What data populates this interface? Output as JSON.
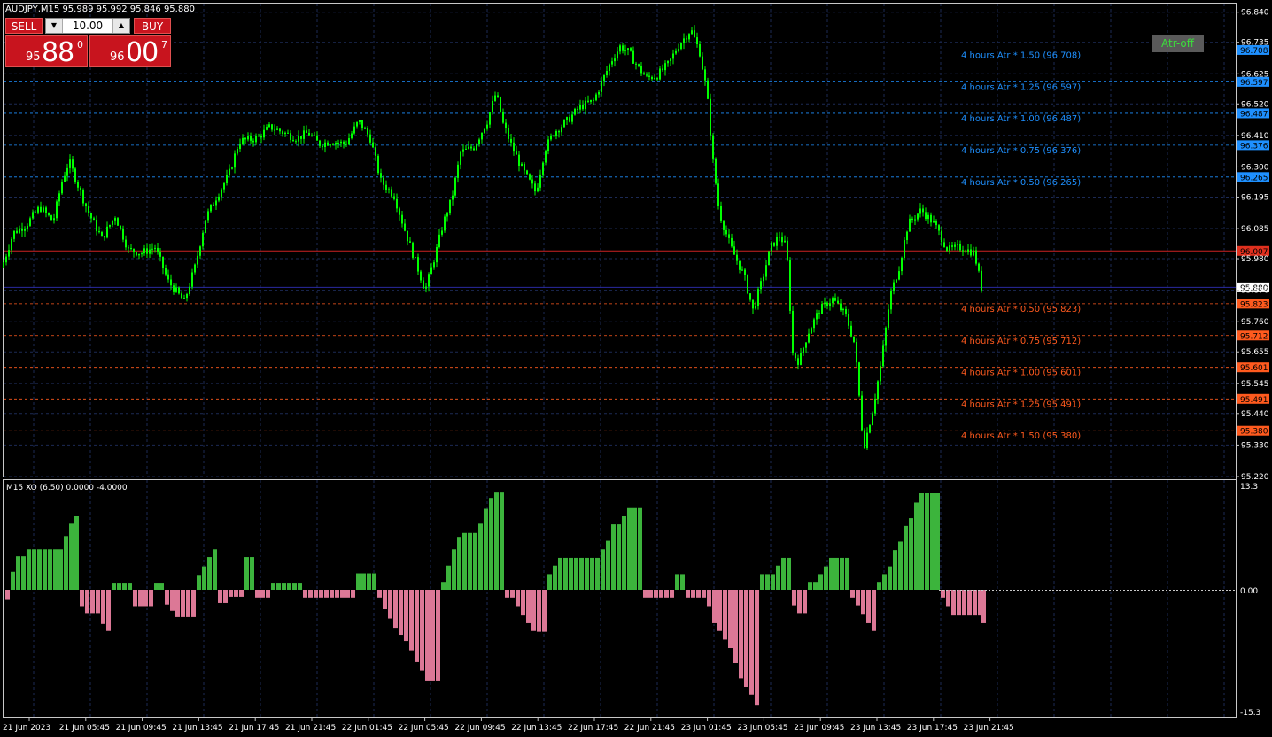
{
  "symbol_header": "AUDJPY,M15  95.989 95.992 95.846 95.880",
  "trade_panel": {
    "sell_label": "SELL",
    "buy_label": "BUY",
    "lot": "10.00",
    "sell_price_small": "95",
    "sell_price_big": "88",
    "sell_price_sup": "0",
    "buy_price_small": "96",
    "buy_price_big": "00",
    "buy_price_sup": "7"
  },
  "atr_button": "Atr-off",
  "indicator_header": "M15 XO (6.50) 0.0000 -4.0000",
  "colors": {
    "bull_candle": "#00ff00",
    "xo_up": "#3cb43c",
    "xo_down": "#dc7896",
    "atr_upper": "#1e90ff",
    "atr_lower": "#ff5a1e",
    "bid_line": "#cc2222",
    "ask_line": "#2a2aa0",
    "grid": "#1c2a55"
  },
  "price_axis_ticks": [
    "96.840",
    "96.735",
    "96.625",
    "96.520",
    "96.410",
    "96.300",
    "96.195",
    "96.085",
    "95.980",
    "95.870",
    "95.760",
    "95.655",
    "95.545",
    "95.440",
    "95.330",
    "95.220"
  ],
  "price_tags": {
    "atr_upper": [
      "96.708",
      "96.597",
      "96.487",
      "96.376",
      "96.265"
    ],
    "atr_lower": [
      "95.823",
      "95.712",
      "95.601",
      "95.491",
      "95.380"
    ],
    "ask": "96.007",
    "bid": "95.880"
  },
  "atr_upper_labels": [
    "4 hours Atr * 1.50 (96.708)",
    "4 hours Atr * 1.25 (96.597)",
    "4 hours Atr * 1.00 (96.487)",
    "4 hours Atr * 0.75 (96.376)",
    "4 hours Atr * 0.50 (96.265)"
  ],
  "atr_lower_labels": [
    "4 hours Atr * 0.50 (95.823)",
    "4 hours Atr * 0.75 (95.712)",
    "4 hours Atr * 1.00 (95.601)",
    "4 hours Atr * 1.25 (95.491)",
    "4 hours Atr * 1.50 (95.380)"
  ],
  "indicator_axis": {
    "max": "13.3",
    "zero": "0.00",
    "min": "-15.3"
  },
  "time_labels": [
    "21 Jun 2023",
    "21 Jun 05:45",
    "21 Jun 09:45",
    "21 Jun 13:45",
    "21 Jun 17:45",
    "21 Jun 21:45",
    "22 Jun 01:45",
    "22 Jun 05:45",
    "22 Jun 09:45",
    "22 Jun 13:45",
    "22 Jun 17:45",
    "22 Jun 21:45",
    "23 Jun 01:45",
    "23 Jun 05:45",
    "23 Jun 09:45",
    "23 Jun 13:45",
    "23 Jun 17:45",
    "23 Jun 21:45"
  ],
  "chart_data": {
    "type": "candlestick",
    "price_range": [
      95.22,
      96.87
    ],
    "close_path": [
      [
        0,
        95.93
      ],
      [
        15,
        96.07
      ],
      [
        30,
        96.1
      ],
      [
        45,
        96.16
      ],
      [
        60,
        96.11
      ],
      [
        70,
        96.25
      ],
      [
        78,
        96.32
      ],
      [
        90,
        96.22
      ],
      [
        100,
        96.14
      ],
      [
        115,
        96.05
      ],
      [
        130,
        96.13
      ],
      [
        145,
        96.01
      ],
      [
        160,
        96.0
      ],
      [
        175,
        96.02
      ],
      [
        190,
        95.9
      ],
      [
        208,
        95.83
      ],
      [
        220,
        95.95
      ],
      [
        232,
        96.12
      ],
      [
        245,
        96.2
      ],
      [
        258,
        96.27
      ],
      [
        270,
        96.39
      ],
      [
        290,
        96.4
      ],
      [
        305,
        96.44
      ],
      [
        320,
        96.42
      ],
      [
        335,
        96.4
      ],
      [
        348,
        96.42
      ],
      [
        360,
        96.38
      ],
      [
        375,
        96.39
      ],
      [
        390,
        96.38
      ],
      [
        405,
        96.46
      ],
      [
        418,
        96.4
      ],
      [
        430,
        96.25
      ],
      [
        445,
        96.2
      ],
      [
        458,
        96.07
      ],
      [
        468,
        95.98
      ],
      [
        480,
        95.87
      ],
      [
        492,
        96.0
      ],
      [
        500,
        96.1
      ],
      [
        510,
        96.19
      ],
      [
        520,
        96.35
      ],
      [
        535,
        96.37
      ],
      [
        550,
        96.46
      ],
      [
        560,
        96.56
      ],
      [
        568,
        96.45
      ],
      [
        578,
        96.37
      ],
      [
        590,
        96.29
      ],
      [
        605,
        96.21
      ],
      [
        615,
        96.36
      ],
      [
        625,
        96.42
      ],
      [
        640,
        96.46
      ],
      [
        655,
        96.51
      ],
      [
        670,
        96.53
      ],
      [
        680,
        96.6
      ],
      [
        690,
        96.67
      ],
      [
        700,
        96.72
      ],
      [
        710,
        96.7
      ],
      [
        720,
        96.65
      ],
      [
        730,
        96.61
      ],
      [
        742,
        96.62
      ],
      [
        755,
        96.66
      ],
      [
        765,
        96.72
      ],
      [
        780,
        96.78
      ],
      [
        790,
        96.7
      ],
      [
        798,
        96.56
      ],
      [
        805,
        96.32
      ],
      [
        812,
        96.14
      ],
      [
        825,
        96.02
      ],
      [
        840,
        95.92
      ],
      [
        850,
        95.8
      ],
      [
        860,
        95.9
      ],
      [
        870,
        96.02
      ],
      [
        880,
        96.06
      ],
      [
        888,
        96.02
      ],
      [
        895,
        95.65
      ],
      [
        902,
        95.62
      ],
      [
        912,
        95.72
      ],
      [
        925,
        95.8
      ],
      [
        940,
        95.84
      ],
      [
        955,
        95.78
      ],
      [
        965,
        95.68
      ],
      [
        975,
        95.32
      ],
      [
        985,
        95.45
      ],
      [
        995,
        95.62
      ],
      [
        1005,
        95.85
      ],
      [
        1015,
        95.95
      ],
      [
        1025,
        96.1
      ],
      [
        1040,
        96.15
      ],
      [
        1055,
        96.1
      ],
      [
        1070,
        96.01
      ],
      [
        1085,
        96.02
      ],
      [
        1100,
        96.0
      ],
      [
        1108,
        95.88
      ]
    ],
    "xo_histogram": [
      [
        6,
        -1.2
      ],
      [
        12,
        2.3
      ],
      [
        18,
        4.3
      ],
      [
        24,
        4.3
      ],
      [
        30,
        5.2
      ],
      [
        36,
        5.2
      ],
      [
        42,
        5.2
      ],
      [
        48,
        5.2
      ],
      [
        54,
        5.2
      ],
      [
        60,
        5.2
      ],
      [
        66,
        5.2
      ],
      [
        72,
        6.9
      ],
      [
        78,
        8.6
      ],
      [
        84,
        9.5
      ],
      [
        90,
        -2.1
      ],
      [
        96,
        -3.0
      ],
      [
        102,
        -3.0
      ],
      [
        108,
        -3.0
      ],
      [
        114,
        -4.3
      ],
      [
        120,
        -5.2
      ],
      [
        126,
        0.9
      ],
      [
        132,
        0.9
      ],
      [
        138,
        0.9
      ],
      [
        144,
        0.9
      ],
      [
        150,
        -2.1
      ],
      [
        156,
        -2.1
      ],
      [
        162,
        -2.1
      ],
      [
        168,
        -2.1
      ],
      [
        174,
        0.9
      ],
      [
        180,
        0.9
      ],
      [
        186,
        -1.9
      ],
      [
        192,
        -2.7
      ],
      [
        198,
        -3.4
      ],
      [
        204,
        -3.4
      ],
      [
        210,
        -3.4
      ],
      [
        216,
        -3.4
      ],
      [
        222,
        1.9
      ],
      [
        228,
        3.0
      ],
      [
        234,
        4.2
      ],
      [
        240,
        5.2
      ],
      [
        246,
        -1.7
      ],
      [
        252,
        -1.7
      ],
      [
        258,
        -0.9
      ],
      [
        264,
        -0.9
      ],
      [
        270,
        -0.9
      ],
      [
        276,
        4.2
      ],
      [
        282,
        4.2
      ],
      [
        288,
        -1.0
      ],
      [
        294,
        -1.0
      ],
      [
        300,
        -1.0
      ],
      [
        306,
        0.9
      ],
      [
        312,
        0.9
      ],
      [
        318,
        0.9
      ],
      [
        324,
        0.9
      ],
      [
        330,
        0.9
      ],
      [
        336,
        0.9
      ],
      [
        342,
        -1.0
      ],
      [
        348,
        -1.0
      ],
      [
        354,
        -1.0
      ],
      [
        360,
        -1.0
      ],
      [
        366,
        -1.0
      ],
      [
        372,
        -1.0
      ],
      [
        378,
        -1.0
      ],
      [
        384,
        -1.0
      ],
      [
        390,
        -1.0
      ],
      [
        396,
        -1.0
      ],
      [
        402,
        2.1
      ],
      [
        408,
        2.1
      ],
      [
        414,
        2.1
      ],
      [
        420,
        2.1
      ],
      [
        426,
        -1.0
      ],
      [
        432,
        -2.5
      ],
      [
        438,
        -3.7
      ],
      [
        444,
        -4.9
      ],
      [
        450,
        -5.8
      ],
      [
        456,
        -6.6
      ],
      [
        462,
        -7.8
      ],
      [
        468,
        -9.2
      ],
      [
        474,
        -10.3
      ],
      [
        480,
        -11.7
      ],
      [
        486,
        -11.7
      ],
      [
        492,
        -11.7
      ],
      [
        498,
        1.0
      ],
      [
        504,
        3.1
      ],
      [
        510,
        5.2
      ],
      [
        516,
        6.8
      ],
      [
        522,
        7.3
      ],
      [
        528,
        7.3
      ],
      [
        534,
        7.3
      ],
      [
        540,
        8.6
      ],
      [
        546,
        10.4
      ],
      [
        552,
        11.8
      ],
      [
        558,
        12.6
      ],
      [
        564,
        12.6
      ],
      [
        570,
        -1.0
      ],
      [
        576,
        -1.0
      ],
      [
        582,
        -2.1
      ],
      [
        588,
        -3.2
      ],
      [
        594,
        -4.2
      ],
      [
        600,
        -5.2
      ],
      [
        606,
        -5.3
      ],
      [
        612,
        -5.3
      ],
      [
        618,
        2.0
      ],
      [
        624,
        3.1
      ],
      [
        630,
        4.1
      ],
      [
        636,
        4.1
      ],
      [
        642,
        4.1
      ],
      [
        648,
        4.1
      ],
      [
        654,
        4.1
      ],
      [
        660,
        4.1
      ],
      [
        666,
        4.1
      ],
      [
        672,
        4.1
      ],
      [
        678,
        5.2
      ],
      [
        684,
        6.3
      ],
      [
        690,
        8.4
      ],
      [
        696,
        8.4
      ],
      [
        702,
        9.5
      ],
      [
        708,
        10.6
      ],
      [
        714,
        10.6
      ],
      [
        720,
        10.6
      ],
      [
        726,
        -1.0
      ],
      [
        732,
        -1.0
      ],
      [
        738,
        -1.0
      ],
      [
        744,
        -1.0
      ],
      [
        750,
        -1.0
      ],
      [
        756,
        -1.0
      ],
      [
        762,
        2.0
      ],
      [
        768,
        2.0
      ],
      [
        774,
        -1.0
      ],
      [
        780,
        -1.0
      ],
      [
        786,
        -1.0
      ],
      [
        792,
        -1.0
      ],
      [
        798,
        -2.1
      ],
      [
        804,
        -4.2
      ],
      [
        810,
        -5.2
      ],
      [
        816,
        -6.3
      ],
      [
        822,
        -7.4
      ],
      [
        828,
        -9.4
      ],
      [
        834,
        -11.3
      ],
      [
        840,
        -12.4
      ],
      [
        846,
        -13.5
      ],
      [
        852,
        -14.8
      ],
      [
        858,
        2.0
      ],
      [
        864,
        2.0
      ],
      [
        870,
        2.0
      ],
      [
        876,
        3.1
      ],
      [
        882,
        4.1
      ],
      [
        888,
        4.1
      ],
      [
        894,
        -2.0
      ],
      [
        900,
        -3.0
      ],
      [
        906,
        -3.0
      ],
      [
        912,
        1.0
      ],
      [
        918,
        1.0
      ],
      [
        924,
        2.0
      ],
      [
        930,
        3.0
      ],
      [
        936,
        4.1
      ],
      [
        942,
        4.1
      ],
      [
        948,
        4.1
      ],
      [
        954,
        4.1
      ],
      [
        960,
        -1.0
      ],
      [
        966,
        -2.0
      ],
      [
        972,
        -3.1
      ],
      [
        978,
        -4.2
      ],
      [
        984,
        -5.2
      ],
      [
        990,
        1.0
      ],
      [
        996,
        2.0
      ],
      [
        1002,
        3.0
      ],
      [
        1008,
        5.1
      ],
      [
        1014,
        6.2
      ],
      [
        1020,
        8.2
      ],
      [
        1026,
        9.2
      ],
      [
        1032,
        11.2
      ],
      [
        1038,
        12.4
      ],
      [
        1044,
        12.4
      ],
      [
        1050,
        12.4
      ],
      [
        1056,
        12.4
      ],
      [
        1062,
        -1.0
      ],
      [
        1068,
        -2.1
      ],
      [
        1074,
        -3.2
      ],
      [
        1080,
        -3.2
      ],
      [
        1086,
        -3.2
      ],
      [
        1092,
        -3.2
      ],
      [
        1098,
        -3.2
      ],
      [
        1104,
        -3.2
      ],
      [
        1108,
        -4.2
      ]
    ]
  }
}
